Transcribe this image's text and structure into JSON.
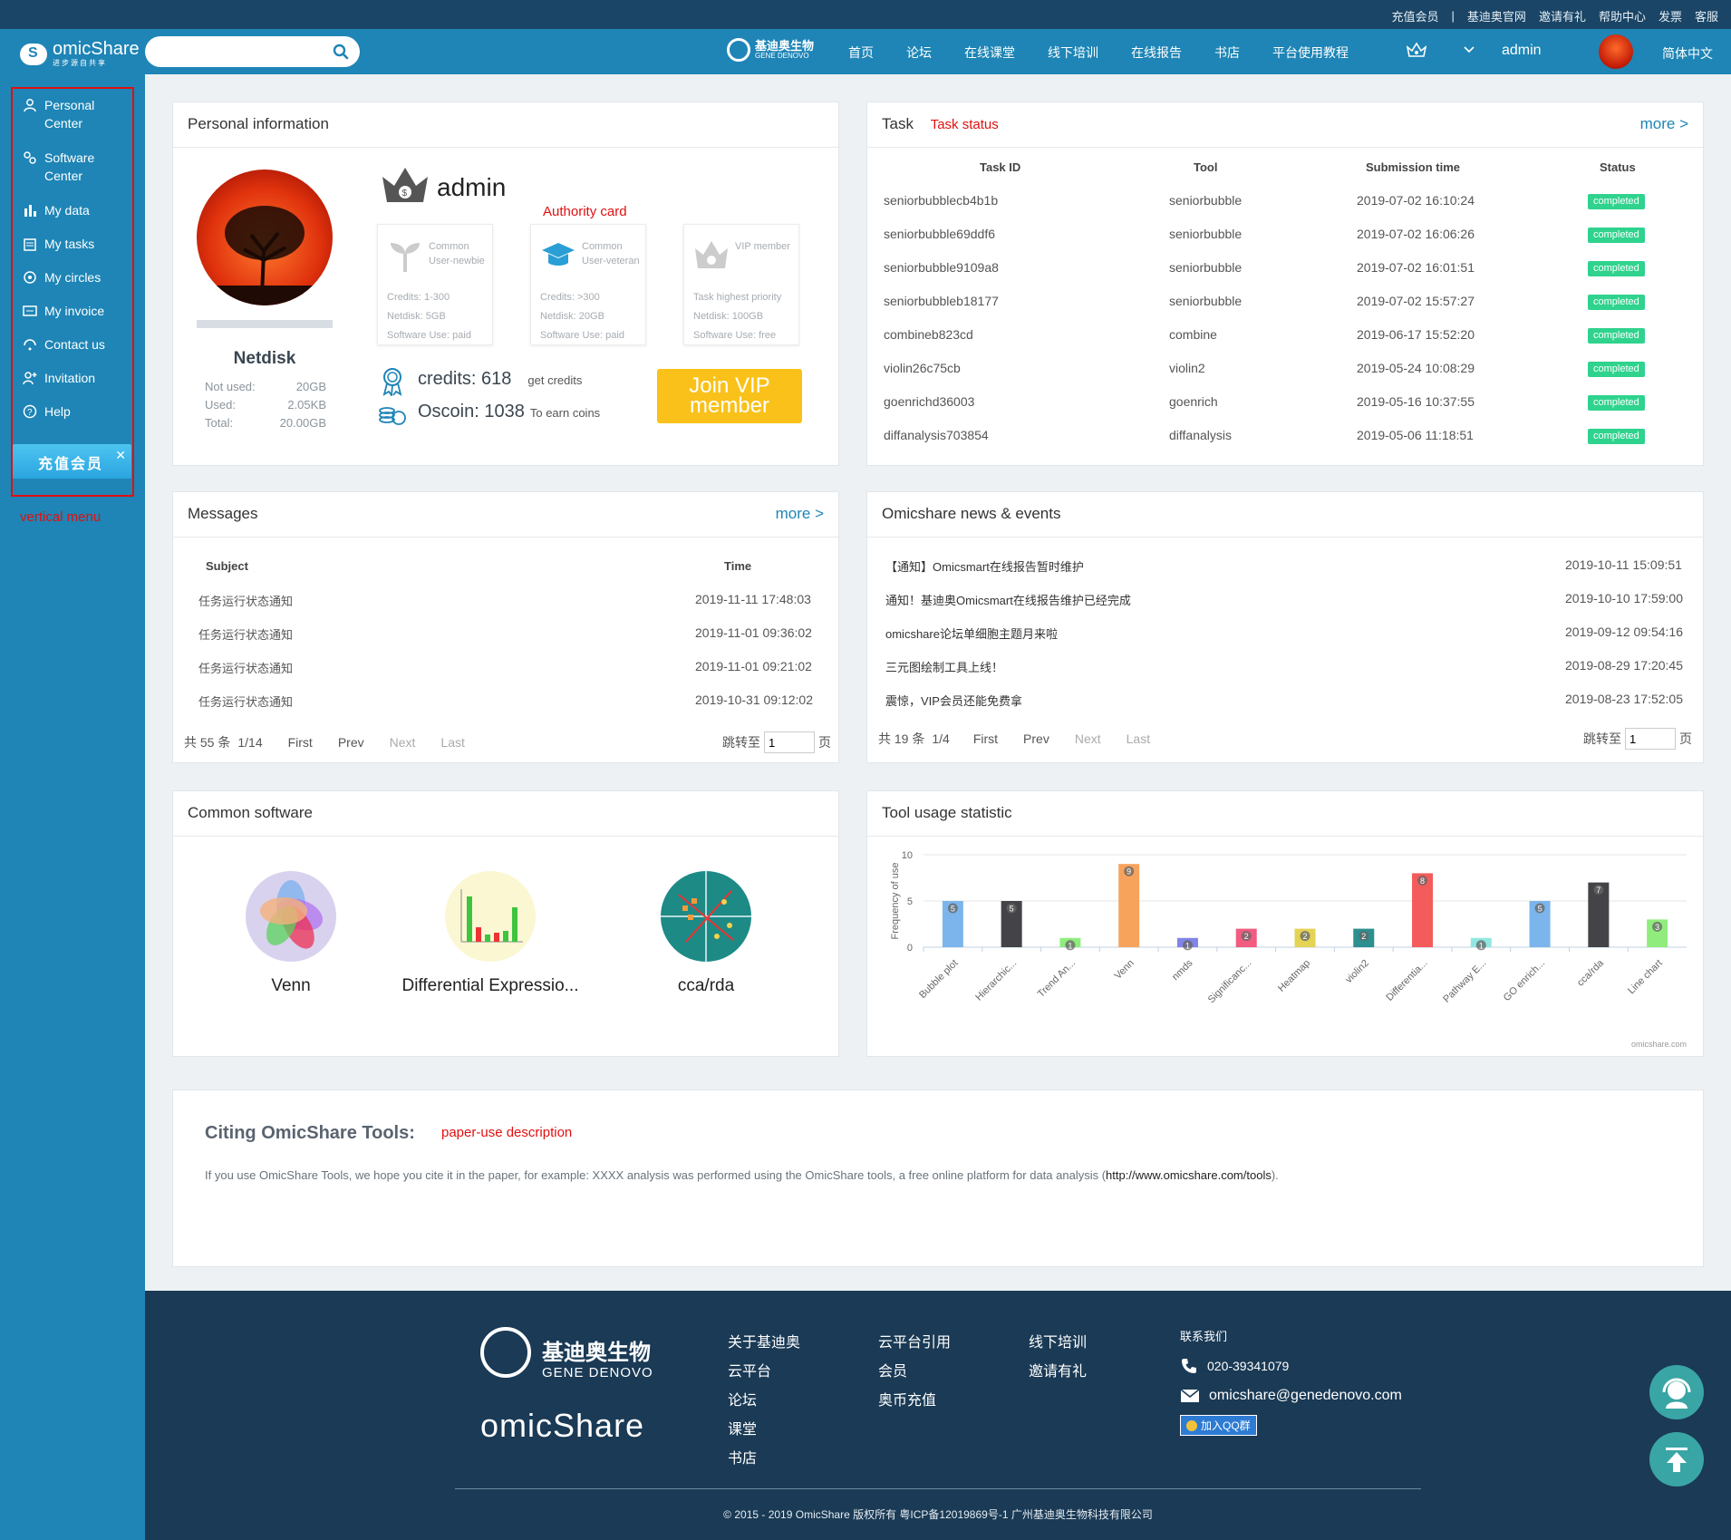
{
  "topbar": {
    "links": [
      "充值会员",
      "|",
      "基迪奥官网",
      "邀请有礼",
      "帮助中心",
      "发票",
      "客服"
    ]
  },
  "logo": {
    "name": "omicShare",
    "sub": "进步源自共享"
  },
  "search": {
    "placeholder": ""
  },
  "brand": {
    "cn": "基迪奥生物",
    "en": "GENE DENOVO"
  },
  "nav": {
    "items": [
      "首页",
      "论坛",
      "在线课堂",
      "线下培训",
      "在线报告",
      "书店",
      "平台使用教程"
    ],
    "user": "admin",
    "lang": "简体中文"
  },
  "sidebar": {
    "items": [
      "Personal Center",
      "Software Center",
      "My data",
      "My tasks",
      "My circles",
      "My invoice",
      "Contact us",
      "Invitation",
      "Help"
    ],
    "banner": "充值会员",
    "annotation": "vertical menu"
  },
  "personal": {
    "title": "Personal information",
    "username": "admin",
    "netdisk": {
      "title": "Netdisk",
      "rows": [
        {
          "k": "Not used:",
          "v": "20GB"
        },
        {
          "k": "Used:",
          "v": "2.05KB"
        },
        {
          "k": "Total:",
          "v": "20.00GB"
        }
      ]
    },
    "auth_label": "Authority card",
    "cards": [
      {
        "title": "Common User-newbie",
        "lines": [
          "Credits: 1-300",
          "Netdisk: 5GB",
          "Software Use: paid"
        ]
      },
      {
        "title": "Common User-veteran",
        "lines": [
          "Credits: >300",
          "Netdisk: 20GB",
          "Software Use: paid"
        ]
      },
      {
        "title": "VIP member",
        "lines": [
          "Task highest priority",
          "Netdisk: 100GB",
          "Software Use: free"
        ]
      }
    ],
    "credits_label": "credits: 618",
    "get_credits": "get credits",
    "oscoin_label": "Oscoin: 1038",
    "earn_coins": "To earn coins",
    "vip_button": "Join VIP member"
  },
  "task": {
    "title": "Task",
    "annotation": "Task status",
    "more": "more >",
    "headers": [
      "Task ID",
      "Tool",
      "Submission time",
      "Status"
    ],
    "rows": [
      [
        "seniorbubblecb4b1b",
        "seniorbubble",
        "2019-07-02 16:10:24",
        "completed"
      ],
      [
        "seniorbubble69ddf6",
        "seniorbubble",
        "2019-07-02 16:06:26",
        "completed"
      ],
      [
        "seniorbubble9109a8",
        "seniorbubble",
        "2019-07-02 16:01:51",
        "completed"
      ],
      [
        "seniorbubbleb18177",
        "seniorbubble",
        "2019-07-02 15:57:27",
        "completed"
      ],
      [
        "combineb823cd",
        "combine",
        "2019-06-17 15:52:20",
        "completed"
      ],
      [
        "violin26c75cb",
        "violin2",
        "2019-05-24 10:08:29",
        "completed"
      ],
      [
        "goenrichd36003",
        "goenrich",
        "2019-05-16 10:37:55",
        "completed"
      ],
      [
        "diffanalysis703854",
        "diffanalysis",
        "2019-05-06 11:18:51",
        "completed"
      ]
    ]
  },
  "messages": {
    "title": "Messages",
    "more": "more >",
    "headers": [
      "Subject",
      "Time"
    ],
    "rows": [
      [
        "任务运行状态通知",
        "2019-11-11 17:48:03"
      ],
      [
        "任务运行状态通知",
        "2019-11-01 09:36:02"
      ],
      [
        "任务运行状态通知",
        "2019-11-01 09:21:02"
      ],
      [
        "任务运行状态通知",
        "2019-10-31 09:12:02"
      ]
    ],
    "pager": {
      "count": "共 55 条",
      "page": "1/14",
      "first": "First",
      "prev": "Prev",
      "next": "Next",
      "last": "Last",
      "jump": "跳转至",
      "input": "1",
      "unit": "页"
    }
  },
  "news": {
    "title": "Omicshare news & events",
    "rows": [
      [
        "【通知】Omicsmart在线报告暂时维护",
        "2019-10-11 15:09:51"
      ],
      [
        "通知！基迪奥Omicsmart在线报告维护已经完成",
        "2019-10-10 17:59:00"
      ],
      [
        "omicshare论坛单细胞主题月来啦",
        "2019-09-12 09:54:16"
      ],
      [
        "三元图绘制工具上线！",
        "2019-08-29 17:20:45"
      ],
      [
        "震惊，VIP会员还能免费拿",
        "2019-08-23 17:52:05"
      ]
    ],
    "pager": {
      "count": "共 19 条",
      "page": "1/4",
      "first": "First",
      "prev": "Prev",
      "next": "Next",
      "last": "Last",
      "jump": "跳转至",
      "input": "1",
      "unit": "页"
    }
  },
  "software": {
    "title": "Common software",
    "items": [
      "Venn",
      "Differential Expressio...",
      "cca/rda"
    ]
  },
  "tool_usage_title": "Tool usage statistic",
  "chart_data": {
    "type": "bar",
    "categories": [
      "Bubble plot",
      "Hierarchic...",
      "Trend An...",
      "Venn",
      "nmds",
      "Significanc...",
      "Heatmap",
      "violin2",
      "Differentia...",
      "Pathway E...",
      "GO enrich...",
      "cca/rda",
      "Line chart"
    ],
    "values": [
      5,
      5,
      1,
      9,
      1,
      2,
      2,
      2,
      8,
      1,
      5,
      7,
      3
    ],
    "colors": [
      "#7cb5ec",
      "#434348",
      "#90ed7d",
      "#f7a35c",
      "#8085e9",
      "#f15c80",
      "#e4d354",
      "#2b908f",
      "#f45b5b",
      "#91e8e1",
      "#7cb5ec",
      "#434348",
      "#90ed7d"
    ],
    "ylabel": "Frequency of use",
    "yticks": [
      "0",
      "5",
      "10"
    ],
    "ylim": [
      0,
      10
    ],
    "credit": "omicshare.com"
  },
  "citing": {
    "title": "Citing OmicShare Tools:",
    "annotation": "paper-use description",
    "text_before": "If you use OmicShare Tools, we hope you cite it in the paper, for example: XXXX analysis was performed using the OmicShare tools, a free online platform for data analysis (",
    "link": "http://www.omicshare.com/tools",
    "text_after": ")."
  },
  "footer": {
    "brand_cn": "基迪奥生物",
    "brand_en": "GENE DENOVO",
    "omic": "omicShare",
    "col1": [
      "关于基迪奥",
      "云平台",
      "论坛",
      "课堂",
      "书店"
    ],
    "col2": [
      "云平台引用",
      "会员",
      "奥币充值"
    ],
    "col3": [
      "线下培训",
      "邀请有礼"
    ],
    "contact_title": "联系我们",
    "phone": "020-39341079",
    "email": "omicshare@genedenovo.com",
    "qq": "加入QQ群",
    "copyright": "© 2015 - 2019 OmicShare 版权所有 粤ICP备12019869号-1 广州基迪奥生物科技有限公司"
  }
}
